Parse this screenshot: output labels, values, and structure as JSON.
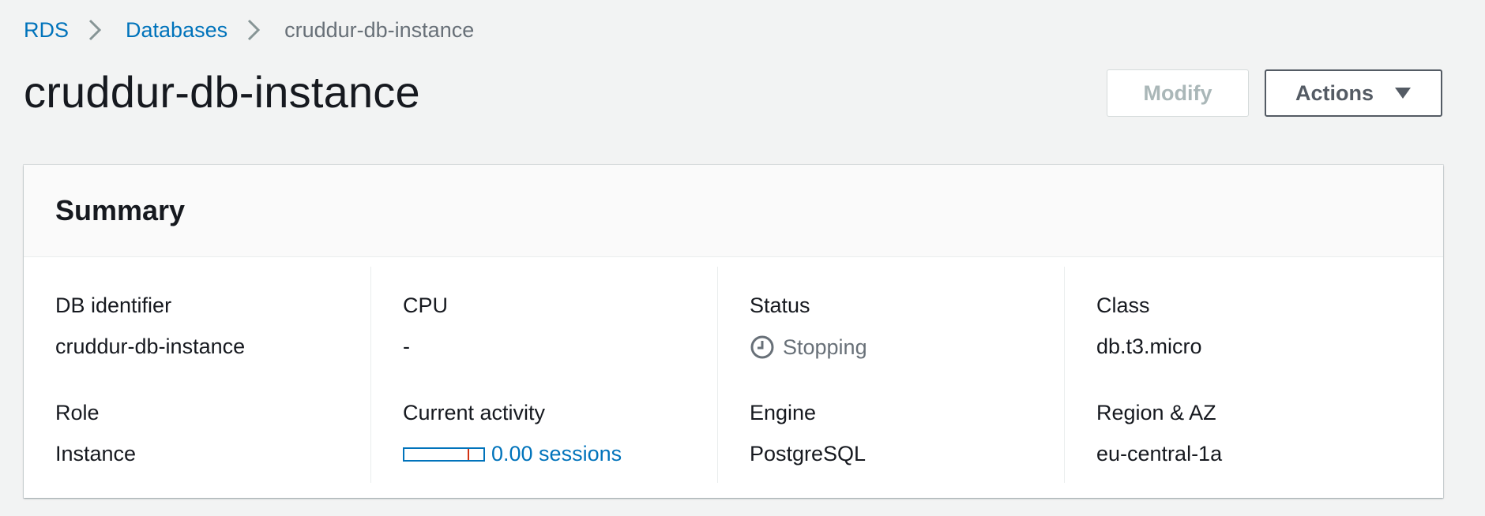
{
  "breadcrumb": {
    "items": [
      "RDS",
      "Databases"
    ],
    "current": "cruddur-db-instance"
  },
  "page": {
    "title": "cruddur-db-instance"
  },
  "buttons": {
    "modify_label": "Modify",
    "actions_label": "Actions"
  },
  "summary": {
    "title": "Summary",
    "db_identifier": {
      "label": "DB identifier",
      "value": "cruddur-db-instance"
    },
    "cpu": {
      "label": "CPU",
      "value": "-"
    },
    "status": {
      "label": "Status",
      "value": "Stopping",
      "icon": "clock-icon"
    },
    "class": {
      "label": "Class",
      "value": "db.t3.micro"
    },
    "role": {
      "label": "Role",
      "value": "Instance"
    },
    "current_activity": {
      "label": "Current activity",
      "value": "0.00 sessions",
      "sessions": 0.0,
      "max_marker_fraction": 0.8
    },
    "engine": {
      "label": "Engine",
      "value": "PostgreSQL"
    },
    "region_az": {
      "label": "Region & AZ",
      "value": "eu-central-1a"
    }
  },
  "colors": {
    "link": "#0073bb",
    "status_stopping": "#687078",
    "activity_max_line": "#d13212"
  }
}
